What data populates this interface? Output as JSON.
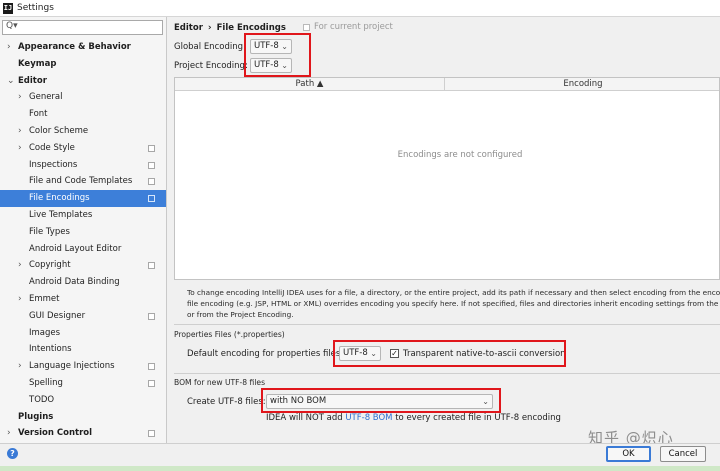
{
  "window": {
    "title": "Settings",
    "app_icon": "intellij-icon"
  },
  "sidebar": {
    "search_glyph": "Q▾",
    "items": [
      {
        "label": "Appearance & Behavior",
        "bold": true,
        "chevron": "›",
        "indent": 0
      },
      {
        "label": "Keymap",
        "bold": true,
        "chevron": "",
        "indent": 0
      },
      {
        "label": "Editor",
        "bold": true,
        "chevron": "⌄",
        "indent": 0
      },
      {
        "label": "General",
        "chevron": "›",
        "indent": 1
      },
      {
        "label": "Font",
        "chevron": "",
        "indent": 1
      },
      {
        "label": "Color Scheme",
        "chevron": "›",
        "indent": 1
      },
      {
        "label": "Code Style",
        "chevron": "›",
        "indent": 1,
        "project": true
      },
      {
        "label": "Inspections",
        "chevron": "",
        "indent": 1,
        "project": true
      },
      {
        "label": "File and Code Templates",
        "chevron": "",
        "indent": 1,
        "project": true
      },
      {
        "label": "File Encodings",
        "chevron": "",
        "indent": 1,
        "project": true,
        "selected": true
      },
      {
        "label": "Live Templates",
        "chevron": "",
        "indent": 1
      },
      {
        "label": "File Types",
        "chevron": "",
        "indent": 1
      },
      {
        "label": "Android Layout Editor",
        "chevron": "",
        "indent": 1
      },
      {
        "label": "Copyright",
        "chevron": "›",
        "indent": 1,
        "project": true
      },
      {
        "label": "Android Data Binding",
        "chevron": "",
        "indent": 1
      },
      {
        "label": "Emmet",
        "chevron": "›",
        "indent": 1
      },
      {
        "label": "GUI Designer",
        "chevron": "",
        "indent": 1,
        "project": true
      },
      {
        "label": "Images",
        "chevron": "",
        "indent": 1
      },
      {
        "label": "Intentions",
        "chevron": "",
        "indent": 1
      },
      {
        "label": "Language Injections",
        "chevron": "›",
        "indent": 1,
        "project": true
      },
      {
        "label": "Spelling",
        "chevron": "",
        "indent": 1,
        "project": true
      },
      {
        "label": "TODO",
        "chevron": "",
        "indent": 1
      },
      {
        "label": "Plugins",
        "bold": true,
        "chevron": "",
        "indent": 0
      },
      {
        "label": "Version Control",
        "bold": true,
        "chevron": "›",
        "indent": 0,
        "project": true
      }
    ]
  },
  "header": {
    "breadcrumb_parent": "Editor",
    "breadcrumb_sep": "›",
    "breadcrumb_current": "File Encodings",
    "for_current_project": "For current project"
  },
  "global_encoding": {
    "label": "Global Encoding:",
    "value": "UTF-8"
  },
  "project_encoding": {
    "label": "Project Encoding:",
    "value": "UTF-8"
  },
  "table": {
    "col_path": "Path ▲",
    "col_encoding": "Encoding",
    "empty_message": "Encodings are not configured"
  },
  "note": {
    "line1": "To change encoding IntelliJ IDEA uses for a file, a directory, or the entire project, add its path if necessary and then select encoding from the encoding li",
    "line2": "file encoding (e.g. JSP, HTML or XML) overrides encoding you specify here. If not specified, files and directories inherit encoding settings from the pare",
    "line3": "or from the Project Encoding."
  },
  "properties": {
    "section_title": "Properties Files (*.properties)",
    "label": "Default encoding for properties files:",
    "value": "UTF-8",
    "checkbox_label": "Transparent native-to-ascii conversion",
    "checkbox_checked": true
  },
  "bom": {
    "section_title": "BOM for new UTF-8 files",
    "label": "Create UTF-8 files:",
    "value": "with NO BOM",
    "info_prefix": "IDEA will NOT add ",
    "info_link": "UTF-8 BOM",
    "info_suffix": " to every created file in UTF-8 encoding"
  },
  "footer": {
    "help": "?",
    "ok": "OK",
    "cancel": "Cancel"
  },
  "watermark": "知乎 @炽心",
  "colors": {
    "accent": "#3d7fd9",
    "highlight": "#e0161b",
    "link": "#2e6fd0"
  }
}
